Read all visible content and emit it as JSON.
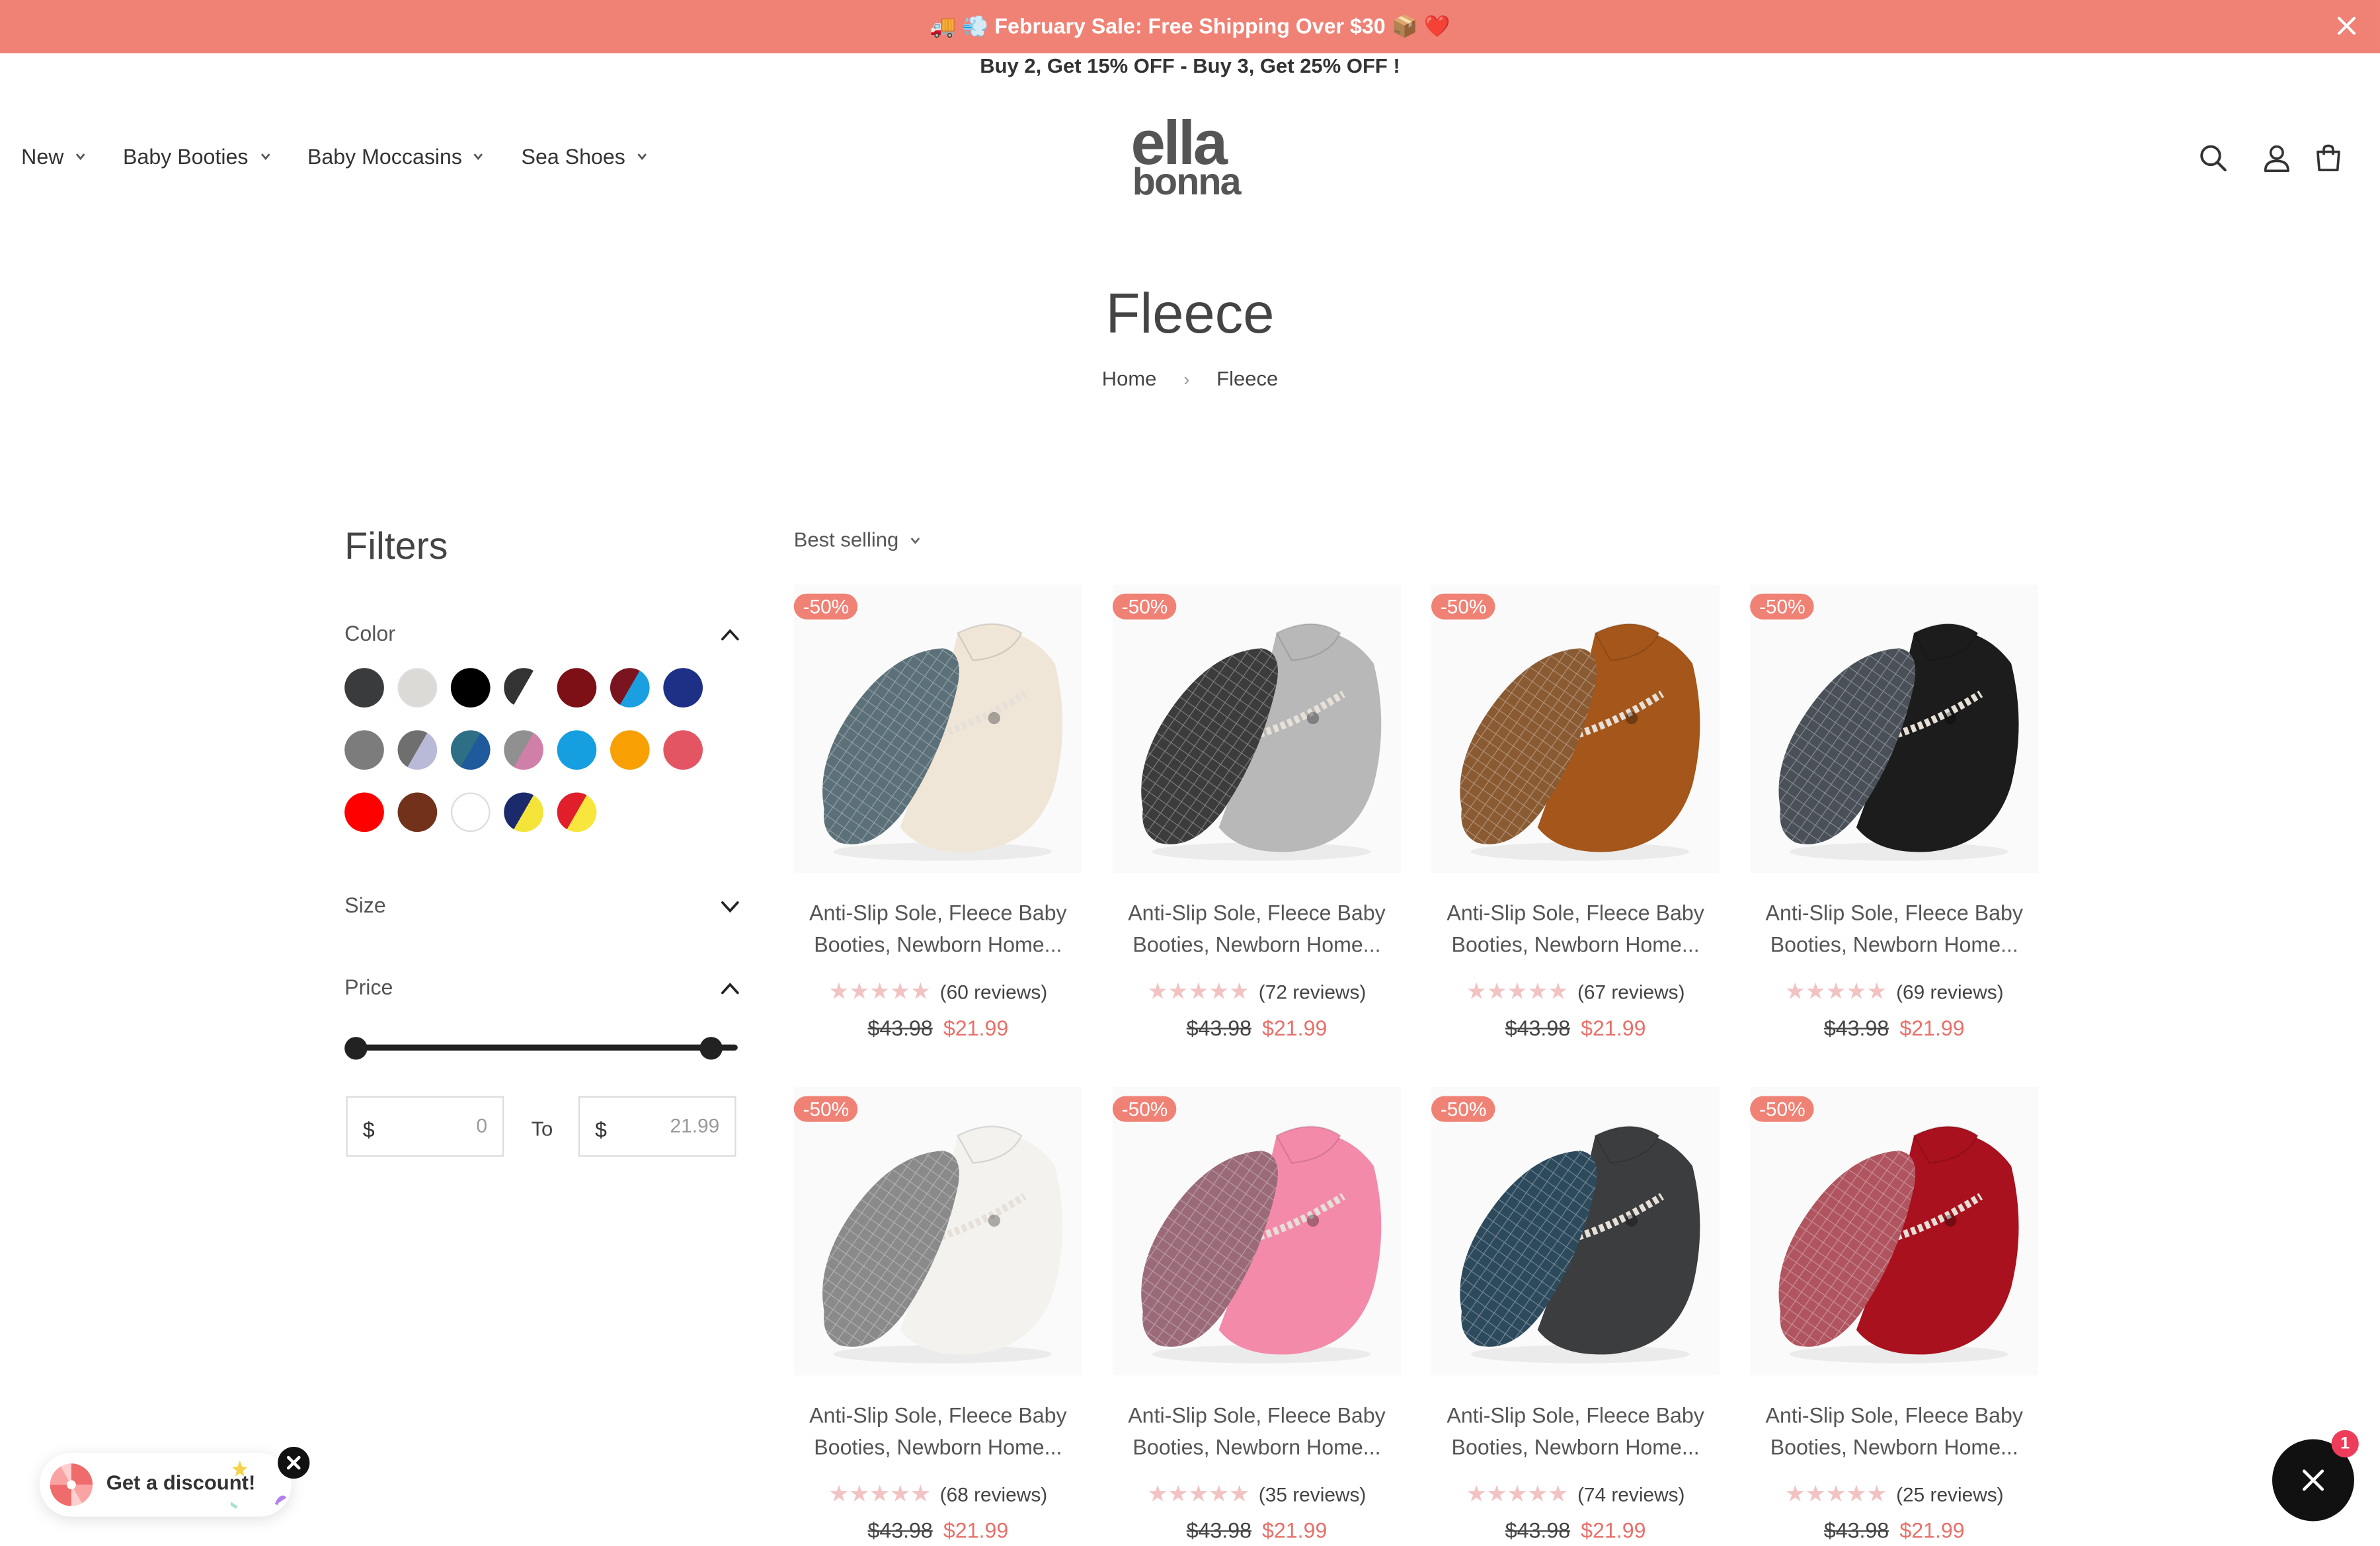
{
  "announcement": {
    "text": "🚚 💨 February Sale: Free Shipping Over $30 📦 ❤️",
    "close_icon": "close-icon"
  },
  "promo": {
    "text": "Buy 2, Get 15% OFF - Buy 3, Get 25% OFF !"
  },
  "nav": {
    "items": [
      {
        "label": "New"
      },
      {
        "label": "Baby Booties"
      },
      {
        "label": "Baby Moccasins"
      },
      {
        "label": "Sea Shoes"
      }
    ]
  },
  "logo": {
    "line1": "ella",
    "line2": "bonna"
  },
  "header_icons": [
    "search-icon",
    "account-icon",
    "cart-icon"
  ],
  "page": {
    "title": "Fleece",
    "breadcrumb": {
      "home": "Home",
      "separator": "›",
      "current": "Fleece"
    }
  },
  "filters": {
    "title": "Filters",
    "color_label": "Color",
    "size_label": "Size",
    "price_label": "Price",
    "swatches": [
      {
        "name": "charcoal",
        "fill": "#3a3b3d"
      },
      {
        "name": "light-grey",
        "fill": "#dcdad6"
      },
      {
        "name": "black",
        "fill": "#000000"
      },
      {
        "name": "black-white",
        "fill": "split:#333333:#ffffff"
      },
      {
        "name": "burgundy",
        "fill": "#7d1016"
      },
      {
        "name": "burgundy-blue",
        "fill": "split:#7a1520:#1aa0e0"
      },
      {
        "name": "navy",
        "fill": "#1e2f86"
      },
      {
        "name": "grey",
        "fill": "#7c7c7c"
      },
      {
        "name": "grey-lilac",
        "fill": "split:#6f6f6f:#b9b9d8"
      },
      {
        "name": "teal-blue",
        "fill": "split:#2e6f86:#1e5a9c"
      },
      {
        "name": "pink-grey",
        "fill": "split:#909090:#d080a8"
      },
      {
        "name": "sky-blue",
        "fill": "#169fe0"
      },
      {
        "name": "orange",
        "fill": "#f8a003"
      },
      {
        "name": "coral",
        "fill": "#e45563"
      },
      {
        "name": "red",
        "fill": "#ff0000"
      },
      {
        "name": "brown",
        "fill": "#72311b"
      },
      {
        "name": "white",
        "fill": "#ffffff"
      },
      {
        "name": "navy-yellow",
        "fill": "split:#1b2a6a:#f4e43a"
      },
      {
        "name": "red-yellow",
        "fill": "split:#e11f2a:#f8e53d"
      }
    ],
    "price": {
      "min_fraction": 0,
      "max_fraction": 1,
      "currency": "$",
      "from_value": "0",
      "to_label": "To",
      "to_value": "21.99"
    }
  },
  "sort": {
    "label": "Best selling"
  },
  "products": [
    {
      "badge": "-50%",
      "name_line1": "Anti-Slip Sole, Fleece Baby",
      "name_line2": "Booties, Newborn Home...",
      "reviews": "(60 reviews)",
      "old_price": "$43.98",
      "price": "$21.99",
      "color": "#efe6d8",
      "sole": "#5b7078"
    },
    {
      "badge": "-50%",
      "name_line1": "Anti-Slip Sole, Fleece Baby",
      "name_line2": "Booties, Newborn Home...",
      "reviews": "(72 reviews)",
      "old_price": "$43.98",
      "price": "$21.99",
      "color": "#b8b8b8",
      "sole": "#3c3c3c"
    },
    {
      "badge": "-50%",
      "name_line1": "Anti-Slip Sole, Fleece Baby",
      "name_line2": "Booties, Newborn Home...",
      "reviews": "(67 reviews)",
      "old_price": "$43.98",
      "price": "$21.99",
      "color": "#a4561b",
      "sole": "#8a5a32"
    },
    {
      "badge": "-50%",
      "name_line1": "Anti-Slip Sole, Fleece Baby",
      "name_line2": "Booties, Newborn Home...",
      "reviews": "(69 reviews)",
      "old_price": "$43.98",
      "price": "$21.99",
      "color": "#1c1c1c",
      "sole": "#4a5058"
    },
    {
      "badge": "-50%",
      "name_line1": "Anti-Slip Sole, Fleece Baby",
      "name_line2": "Booties, Newborn Home...",
      "reviews": "(68 reviews)",
      "old_price": "$43.98",
      "price": "$21.99",
      "color": "#f3f2ee",
      "sole": "#8a8a8a"
    },
    {
      "badge": "-50%",
      "name_line1": "Anti-Slip Sole, Fleece Baby",
      "name_line2": "Booties, Newborn Home...",
      "reviews": "(35 reviews)",
      "old_price": "$43.98",
      "price": "$21.99",
      "color": "#f48aaa",
      "sole": "#9a6a78"
    },
    {
      "badge": "-50%",
      "name_line1": "Anti-Slip Sole, Fleece Baby",
      "name_line2": "Booties, Newborn Home...",
      "reviews": "(74 reviews)",
      "old_price": "$43.98",
      "price": "$21.99",
      "color": "#3b3d3f",
      "sole": "#2d4a5c"
    },
    {
      "badge": "-50%",
      "name_line1": "Anti-Slip Sole, Fleece Baby",
      "name_line2": "Booties, Newborn Home...",
      "reviews": "(25 reviews)",
      "old_price": "$43.98",
      "price": "$21.99",
      "color": "#a8111d",
      "sole": "#b05560"
    }
  ],
  "rating_stars": "★★★★★",
  "discount_widget": {
    "label": "Get a discount!"
  },
  "chat_widget": {
    "badge": "1"
  },
  "colors": {
    "accent": "#f08175",
    "sale_price": "#e8706a",
    "star": "#f2c3c3"
  }
}
